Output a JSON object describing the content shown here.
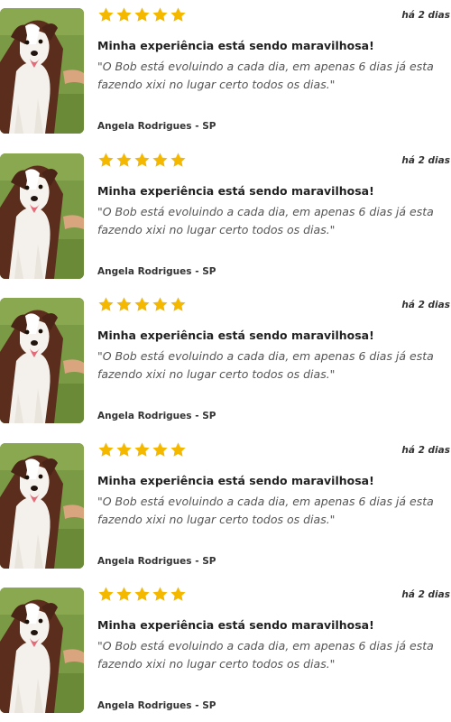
{
  "colors": {
    "star": "#f5b800",
    "text_dark": "#222222",
    "text_quote": "#555555"
  },
  "icons": {
    "rating": "star-icon",
    "photo": "dog-photo"
  },
  "reviews": [
    {
      "rating": 5,
      "time": "há 2 dias",
      "title": "Minha experiência está sendo maravilhosa!",
      "quote": "\"O Bob está evoluindo a cada dia, em apenas 6 dias já esta fazendo xixi no lugar certo todos os dias.\"",
      "author": "Angela Rodrigues - SP"
    },
    {
      "rating": 5,
      "time": "há 2 dias",
      "title": "Minha experiência está sendo maravilhosa!",
      "quote": "\"O Bob está evoluindo a cada dia, em apenas 6 dias já esta fazendo xixi no lugar certo todos os dias.\"",
      "author": "Angela Rodrigues - SP"
    },
    {
      "rating": 5,
      "time": "há 2 dias",
      "title": "Minha experiência está sendo maravilhosa!",
      "quote": "\"O Bob está evoluindo a cada dia, em apenas 6 dias já esta fazendo xixi no lugar certo todos os dias.\"",
      "author": "Angela Rodrigues - SP"
    },
    {
      "rating": 5,
      "time": "há 2 dias",
      "title": "Minha experiência está sendo maravilhosa!",
      "quote": "\"O Bob está evoluindo a cada dia, em apenas 6 dias já esta fazendo xixi no lugar certo todos os dias.\"",
      "author": "Angela Rodrigues - SP"
    },
    {
      "rating": 5,
      "time": "há 2 dias",
      "title": "Minha experiência está sendo maravilhosa!",
      "quote": "\"O Bob está evoluindo a cada dia, em apenas 6 dias já esta fazendo xixi no lugar certo todos os dias.\"",
      "author": "Angela Rodrigues - SP"
    }
  ]
}
